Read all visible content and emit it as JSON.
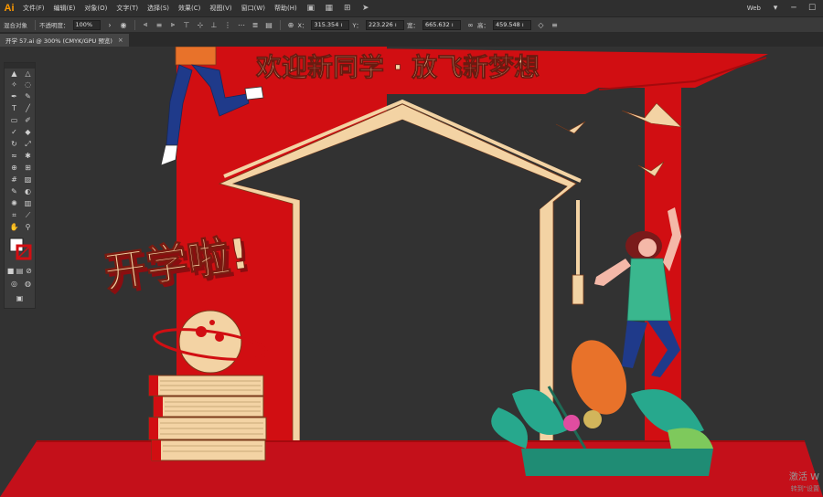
{
  "app": {
    "logo": "Ai"
  },
  "menu": {
    "items": [
      "文件(F)",
      "编辑(E)",
      "对象(O)",
      "文字(T)",
      "选择(S)",
      "效果(C)",
      "视图(V)",
      "窗口(W)",
      "帮助(H)"
    ],
    "workspace": "Web",
    "icons": [
      "bridge-icon",
      "stock-icon",
      "grid-icon",
      "send-icon"
    ]
  },
  "control": {
    "object_type": "混合对象",
    "opacity_label": "不透明度：",
    "opacity_value": "100%",
    "x_label": "X：",
    "x_value": "315.354 ı",
    "y_label": "Y：",
    "y_value": "223.226 ı",
    "w_label": "宽：",
    "w_value": "665.632 ı",
    "h_label": "高：",
    "h_value": "459.548 ı"
  },
  "tab": {
    "title": "开学 57.ai @ 300% (CMYK/GPU 预览)",
    "close": "×"
  },
  "artwork": {
    "banner_text": "欢迎新同学 · 放飞新梦想",
    "headline": "开学啦!",
    "colors": {
      "red": "#d10e12",
      "cream": "#f3d3a4",
      "dark_red": "#a40a0d",
      "teal": "#27a88d",
      "orange": "#e8722a"
    }
  },
  "watermark": {
    "line1": "激活 W",
    "line2": "转到\"设置"
  }
}
